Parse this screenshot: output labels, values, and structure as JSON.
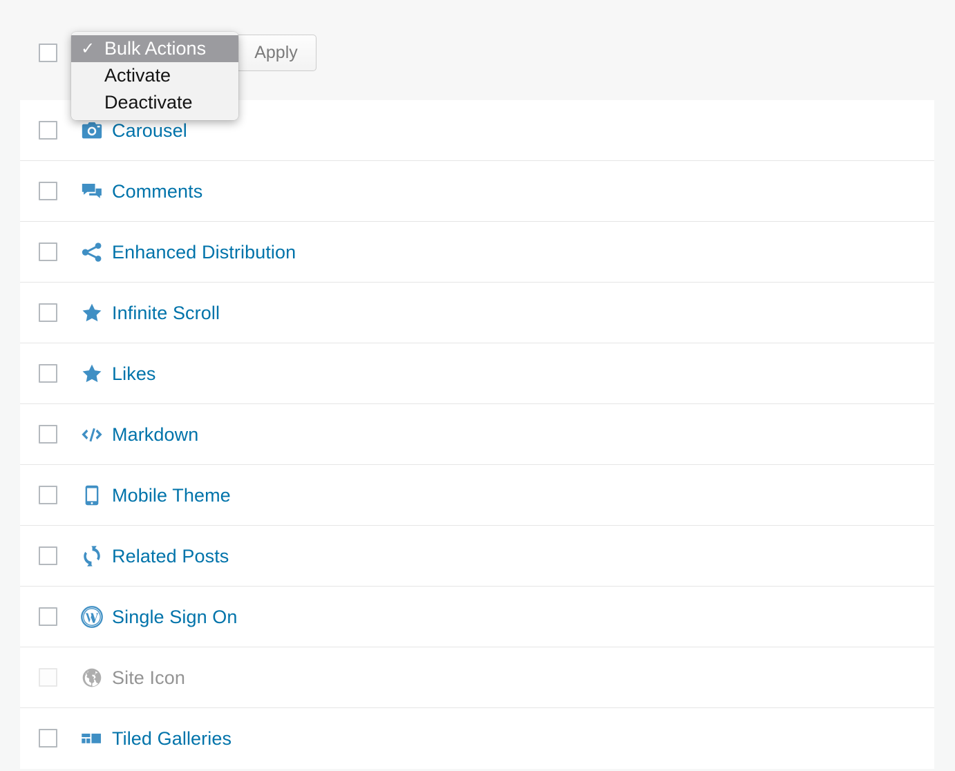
{
  "bulk_actions": {
    "select_value": "Bulk Actions",
    "apply_label": "Apply",
    "checkmark": "✓",
    "options": [
      {
        "label": "Bulk Actions",
        "selected": true
      },
      {
        "label": "Activate",
        "selected": false
      },
      {
        "label": "Deactivate",
        "selected": false
      }
    ]
  },
  "colors": {
    "link_blue": "#0073aa",
    "icon_blue": "#3f8fc4",
    "disabled_gray": "#949494",
    "icon_disabled_gray": "#aeaeae",
    "row_border": "#e5e5e5",
    "page_background": "#f6f7f7",
    "header_background": "#f7f7f7",
    "checkbox_border": "#b4b9be",
    "menu_highlight": "#9b9b9f"
  },
  "plugins": [
    {
      "name": "Carousel",
      "icon": "camera-icon",
      "enabled": true
    },
    {
      "name": "Comments",
      "icon": "comments-icon",
      "enabled": true
    },
    {
      "name": "Enhanced Distribution",
      "icon": "share-icon",
      "enabled": true
    },
    {
      "name": "Infinite Scroll",
      "icon": "star-icon",
      "enabled": true
    },
    {
      "name": "Likes",
      "icon": "star-icon",
      "enabled": true
    },
    {
      "name": "Markdown",
      "icon": "code-icon",
      "enabled": true
    },
    {
      "name": "Mobile Theme",
      "icon": "smartphone-icon",
      "enabled": true
    },
    {
      "name": "Related Posts",
      "icon": "refresh-icon",
      "enabled": true
    },
    {
      "name": "Single Sign On",
      "icon": "wordpress-logo-icon",
      "enabled": true
    },
    {
      "name": "Site Icon",
      "icon": "globe-icon",
      "enabled": false
    },
    {
      "name": "Tiled Galleries",
      "icon": "grid-icon",
      "enabled": true
    }
  ]
}
